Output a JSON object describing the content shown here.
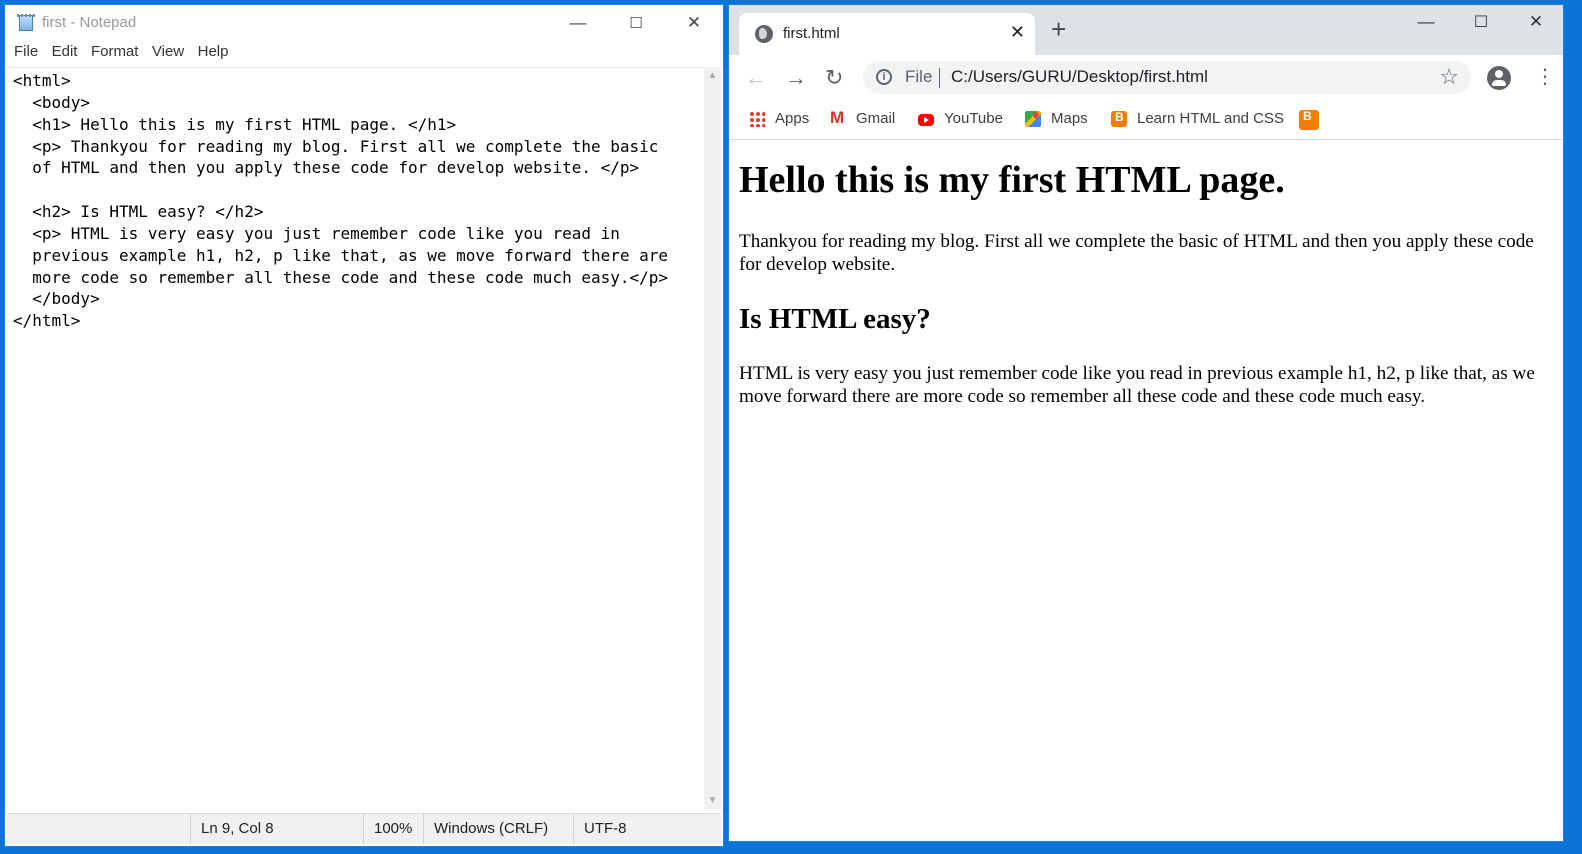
{
  "notepad": {
    "title": "first - Notepad",
    "menu": [
      "File",
      "Edit",
      "Format",
      "View",
      "Help"
    ],
    "content": "<html>\n  <body>\n  <h1> Hello this is my first HTML page. </h1>\n  <p> Thankyou for reading my blog. First all we complete the basic\n  of HTML and then you apply these code for develop website. </p>\n\n  <h2> Is HTML easy? </h2>\n  <p> HTML is very easy you just remember code like you read in\n  previous example h1, h2, p like that, as we move forward there are\n  more code so remember all these code and these code much easy.</p>\n  </body>\n</html>",
    "status": {
      "position": "Ln 9, Col 8",
      "zoom": "100%",
      "line_ending": "Windows (CRLF)",
      "encoding": "UTF-8"
    },
    "window_controls": {
      "minimize": "—",
      "maximize": "☐",
      "close": "✕"
    }
  },
  "chrome": {
    "tab_title": "first.html",
    "tab_close": "✕",
    "new_tab": "+",
    "window_controls": {
      "minimize": "—",
      "maximize": "☐",
      "close": "✕"
    },
    "nav": {
      "back": "←",
      "forward": "→",
      "reload": "↻"
    },
    "omnibox": {
      "scheme": "File",
      "url": "C:/Users/GURU/Desktop/first.html",
      "info": "i",
      "star": "☆"
    },
    "menu_glyph": "⋮",
    "bookmarks": [
      {
        "label": "Apps",
        "icon": "apps-grid-icon"
      },
      {
        "label": "Gmail",
        "icon": "gmail-icon"
      },
      {
        "label": "YouTube",
        "icon": "youtube-icon"
      },
      {
        "label": "Maps",
        "icon": "maps-icon"
      },
      {
        "label": "Learn HTML and CSS",
        "icon": "blogger-icon"
      },
      {
        "label": "",
        "icon": "blogger-icon"
      }
    ]
  },
  "rendered_page": {
    "h1": "Hello this is my first HTML page.",
    "p1": "Thankyou for reading my blog. First all we complete the basic of HTML and then you apply these code for develop website.",
    "h2": "Is HTML easy?",
    "p2": "HTML is very easy you just remember code like you read in previous example h1, h2, p like that, as we move forward there are more code so remember all these code and these code much easy."
  }
}
